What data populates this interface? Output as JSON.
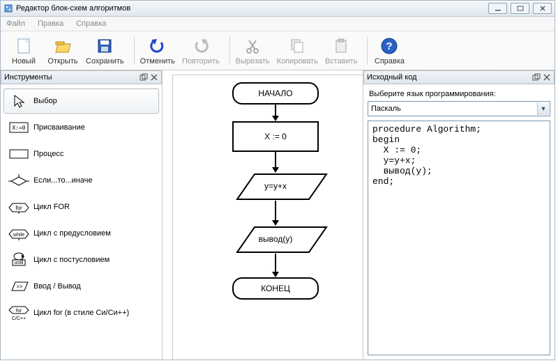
{
  "window": {
    "title": "Редактор блок-схем алгоритмов"
  },
  "menu": {
    "file": "Файл",
    "edit": "Правка",
    "help": "Справка"
  },
  "toolbar": {
    "new": "Новый",
    "open": "Открыть",
    "save": "Сохранить",
    "undo": "Отменить",
    "redo": "Повторить",
    "cut": "Вырезать",
    "copy": "Копировать",
    "paste": "Вставить",
    "help": "Справка"
  },
  "tools": {
    "title": "Инструменты",
    "items": [
      {
        "label": "Выбор"
      },
      {
        "label": "Присваивание"
      },
      {
        "label": "Процесс"
      },
      {
        "label": "Если...то...иначе"
      },
      {
        "label": "Цикл FOR"
      },
      {
        "label": "Цикл с предусловием"
      },
      {
        "label": "Цикл с постусловием"
      },
      {
        "label": "Ввод / Вывод"
      },
      {
        "label": "Цикл for (в стиле Си/Си++)"
      }
    ]
  },
  "flowchart": {
    "start": "НАЧАЛО",
    "assign": "X := 0",
    "process": "y=y+x",
    "io": "вывод(y)",
    "end": "КОНЕЦ"
  },
  "source": {
    "title": "Исходный код",
    "lang_label": "Выберите язык программирования:",
    "lang_selected": "Паскаль",
    "code": "procedure Algorithm;\nbegin\n  X := 0;\n  y=y+x;\n  вывод(y);\nend;"
  }
}
